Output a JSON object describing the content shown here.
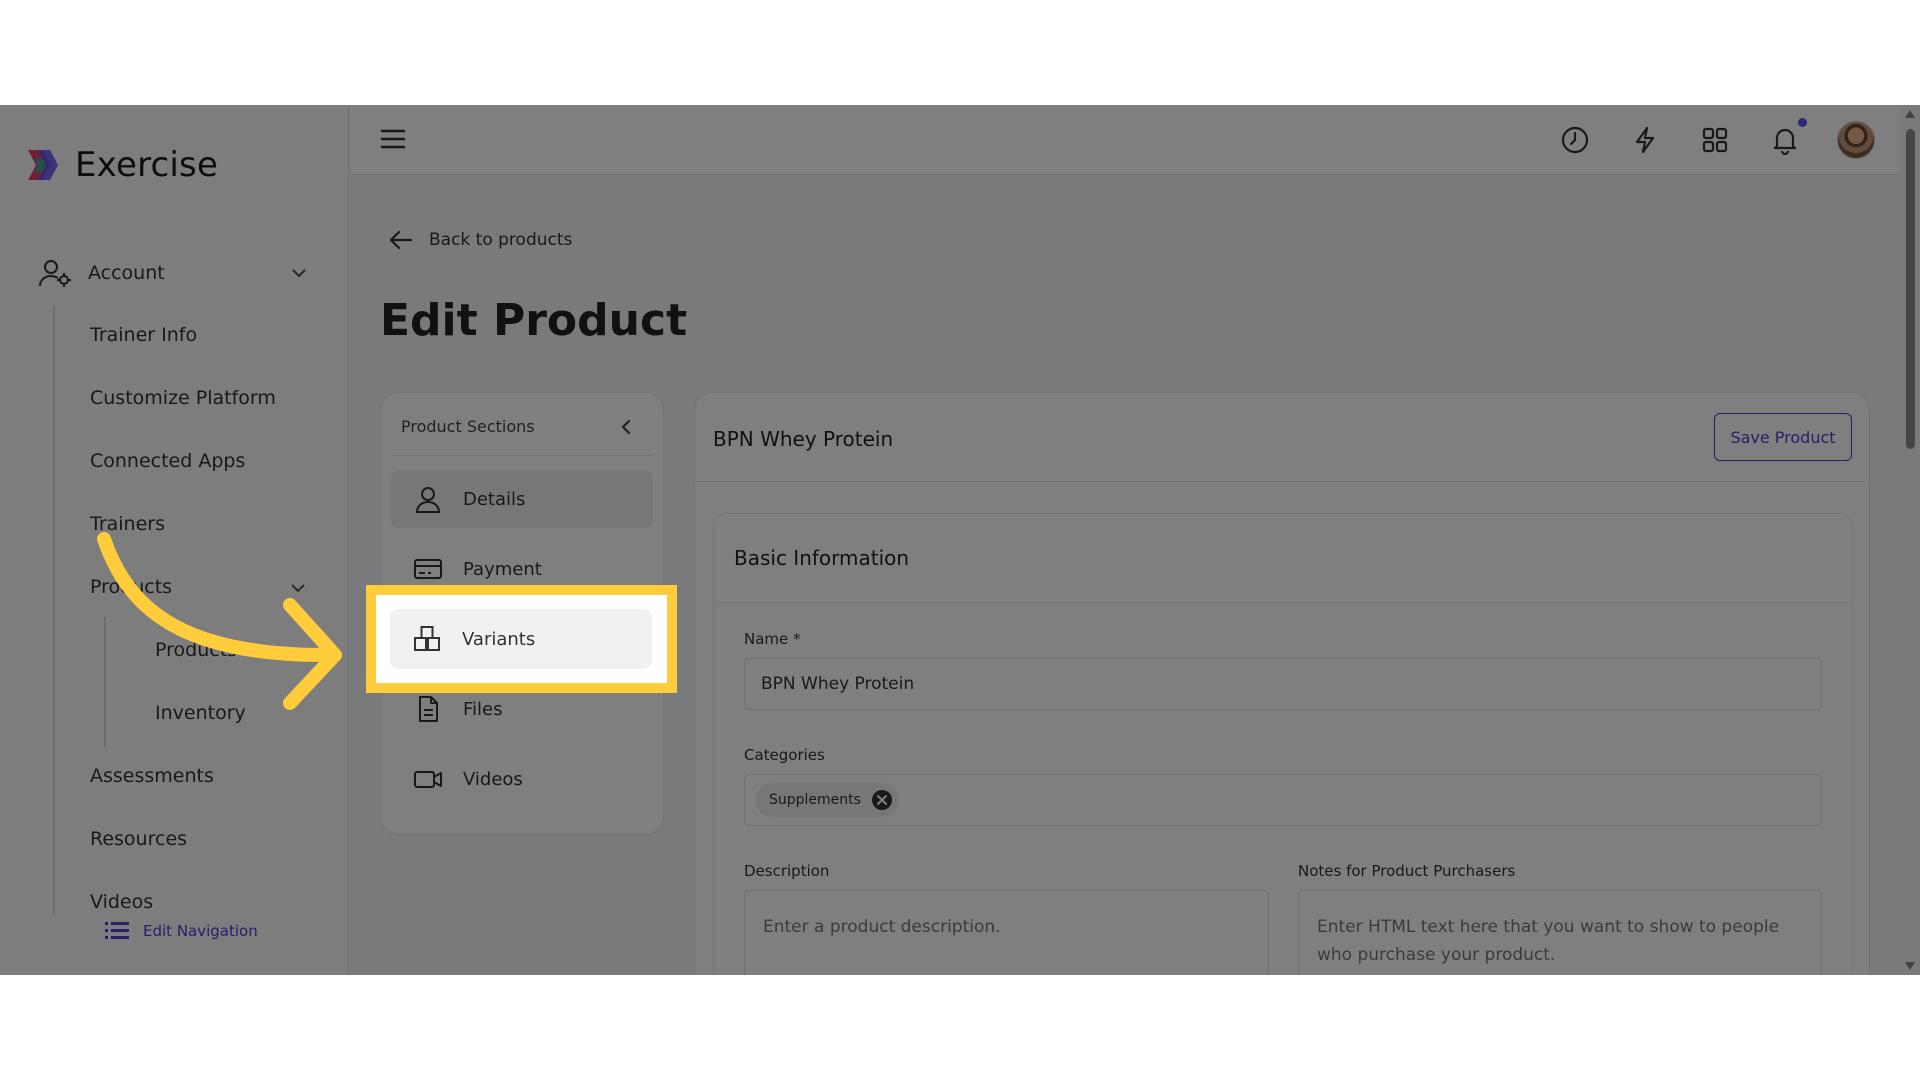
{
  "app": {
    "name": "Exercise"
  },
  "sidebar": {
    "account_label": "Account",
    "items": [
      {
        "label": "Trainer Info"
      },
      {
        "label": "Customize Platform"
      },
      {
        "label": "Connected Apps"
      },
      {
        "label": "Trainers"
      },
      {
        "label": "Products"
      },
      {
        "label": "Products"
      },
      {
        "label": "Inventory"
      },
      {
        "label": "Assessments"
      },
      {
        "label": "Resources"
      },
      {
        "label": "Videos"
      }
    ],
    "edit_navigation": "Edit Navigation"
  },
  "topbar": {
    "icons": [
      "menu-icon",
      "clock-icon",
      "lightning-icon",
      "grid-icon",
      "bell-icon",
      "avatar"
    ]
  },
  "main": {
    "back_label": "Back to products",
    "title": "Edit Product",
    "sections": {
      "heading": "Product Sections",
      "items": [
        {
          "label": "Details",
          "icon": "user-icon"
        },
        {
          "label": "Payment",
          "icon": "credit-card-icon"
        },
        {
          "label": "Variants",
          "icon": "boxes-icon"
        },
        {
          "label": "Files",
          "icon": "file-icon"
        },
        {
          "label": "Videos",
          "icon": "video-icon"
        }
      ]
    },
    "product": {
      "name": "BPN Whey Protein",
      "save_label": "Save Product",
      "basic_info_title": "Basic Information",
      "name_label": "Name *",
      "name_value": "BPN Whey Protein",
      "categories_label": "Categories",
      "categories": [
        "Supplements"
      ],
      "description_label": "Description",
      "description_placeholder": "Enter a product description.",
      "notes_label": "Notes for Product Purchasers",
      "notes_placeholder": "Enter HTML text here that you want to show to people who purchase your product."
    }
  },
  "colors": {
    "accent": "#4b3fd8",
    "highlight": "#ffcd3c"
  }
}
